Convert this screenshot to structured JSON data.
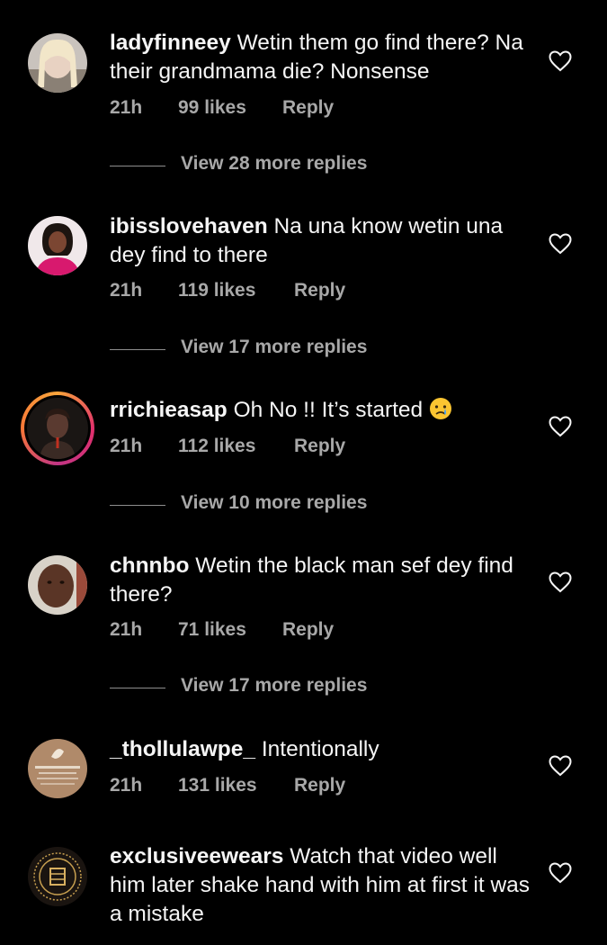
{
  "colors": {
    "background": "#000000",
    "text_primary": "#f5f5f5",
    "text_secondary": "#a8a8a8",
    "story_ring": [
      "#f9a53b",
      "#e1306c",
      "#c13584"
    ]
  },
  "comments": [
    {
      "username": "ladyfinneey",
      "text": "Wetin them go find there? Na their grandmama die? Nonsense",
      "time": "21h",
      "likes": "99 likes",
      "reply": "Reply",
      "view_replies": "View 28 more replies",
      "icon": "heart-outline-icon"
    },
    {
      "username": "ibisslovehaven",
      "text": "Na una know wetin una dey find to there",
      "time": "21h",
      "likes": "119 likes",
      "reply": "Reply",
      "view_replies": "View 17 more replies",
      "icon": "heart-outline-icon"
    },
    {
      "username": "rrichieasap",
      "text": "Oh No !! It’s started",
      "emoji": "crying-face-emoji",
      "time": "21h",
      "likes": "112 likes",
      "reply": "Reply",
      "view_replies": "View 10 more replies",
      "icon": "heart-outline-icon"
    },
    {
      "username": "chnnbo",
      "text": "Wetin the black man sef dey find there?",
      "time": "21h",
      "likes": "71 likes",
      "reply": "Reply",
      "view_replies": "View 17 more replies",
      "icon": "heart-outline-icon"
    },
    {
      "username": "_thollulawpe_",
      "text": "Intentionally",
      "time": "21h",
      "likes": "131 likes",
      "reply": "Reply",
      "icon": "heart-outline-icon"
    },
    {
      "username": "exclusiveewears",
      "text": "Watch that video well him later shake hand with him at first it was a mistake",
      "icon": "heart-outline-icon"
    }
  ]
}
